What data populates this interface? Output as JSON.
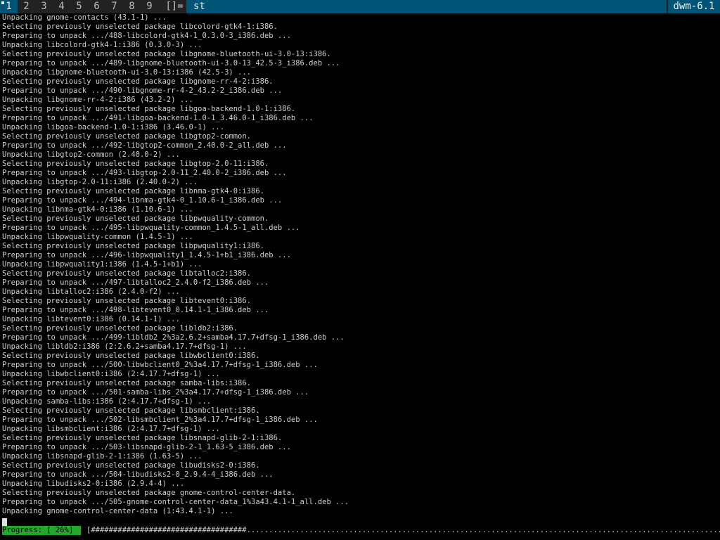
{
  "topbar": {
    "tags": [
      "1",
      "2",
      "3",
      "4",
      "5",
      "6",
      "7",
      "8",
      "9"
    ],
    "selected_tag": "1",
    "layout": "[]=",
    "window_title": "st",
    "status": "dwm-6.1"
  },
  "colors": {
    "bar_bg": "#222222",
    "accent": "#005577",
    "progress_green": "#22a82a"
  },
  "terminal": {
    "lines": [
      "Unpacking gnome-contacts (43.1-1) ...",
      "Selecting previously unselected package libcolord-gtk4-1:i386.",
      "Preparing to unpack .../488-libcolord-gtk4-1_0.3.0-3_i386.deb ...",
      "Unpacking libcolord-gtk4-1:i386 (0.3.0-3) ...",
      "Selecting previously unselected package libgnome-bluetooth-ui-3.0-13:i386.",
      "Preparing to unpack .../489-libgnome-bluetooth-ui-3.0-13_42.5-3_i386.deb ...",
      "Unpacking libgnome-bluetooth-ui-3.0-13:i386 (42.5-3) ...",
      "Selecting previously unselected package libgnome-rr-4-2:i386.",
      "Preparing to unpack .../490-libgnome-rr-4-2_43.2-2_i386.deb ...",
      "Unpacking libgnome-rr-4-2:i386 (43.2-2) ...",
      "Selecting previously unselected package libgoa-backend-1.0-1:i386.",
      "Preparing to unpack .../491-libgoa-backend-1.0-1_3.46.0-1_i386.deb ...",
      "Unpacking libgoa-backend-1.0-1:i386 (3.46.0-1) ...",
      "Selecting previously unselected package libgtop2-common.",
      "Preparing to unpack .../492-libgtop2-common_2.40.0-2_all.deb ...",
      "Unpacking libgtop2-common (2.40.0-2) ...",
      "Selecting previously unselected package libgtop-2.0-11:i386.",
      "Preparing to unpack .../493-libgtop-2.0-11_2.40.0-2_i386.deb ...",
      "Unpacking libgtop-2.0-11:i386 (2.40.0-2) ...",
      "Selecting previously unselected package libnma-gtk4-0:i386.",
      "Preparing to unpack .../494-libnma-gtk4-0_1.10.6-1_i386.deb ...",
      "Unpacking libnma-gtk4-0:i386 (1.10.6-1) ...",
      "Selecting previously unselected package libpwquality-common.",
      "Preparing to unpack .../495-libpwquality-common_1.4.5-1_all.deb ...",
      "Unpacking libpwquality-common (1.4.5-1) ...",
      "Selecting previously unselected package libpwquality1:i386.",
      "Preparing to unpack .../496-libpwquality1_1.4.5-1+b1_i386.deb ...",
      "Unpacking libpwquality1:i386 (1.4.5-1+b1) ...",
      "Selecting previously unselected package libtalloc2:i386.",
      "Preparing to unpack .../497-libtalloc2_2.4.0-f2_i386.deb ...",
      "Unpacking libtalloc2:i386 (2.4.0-f2) ...",
      "Selecting previously unselected package libtevent0:i386.",
      "Preparing to unpack .../498-libtevent0_0.14.1-1_i386.deb ...",
      "Unpacking libtevent0:i386 (0.14.1-1) ...",
      "Selecting previously unselected package libldb2:i386.",
      "Preparing to unpack .../499-libldb2_2%3a2.6.2+samba4.17.7+dfsg-1_i386.deb ...",
      "Unpacking libldb2:i386 (2:2.6.2+samba4.17.7+dfsg-1) ...",
      "Selecting previously unselected package libwbclient0:i386.",
      "Preparing to unpack .../500-libwbclient0_2%3a4.17.7+dfsg-1_i386.deb ...",
      "Unpacking libwbclient0:i386 (2:4.17.7+dfsg-1) ...",
      "Selecting previously unselected package samba-libs:i386.",
      "Preparing to unpack .../501-samba-libs_2%3a4.17.7+dfsg-1_i386.deb ...",
      "Unpacking samba-libs:i386 (2:4.17.7+dfsg-1) ...",
      "Selecting previously unselected package libsmbclient:i386.",
      "Preparing to unpack .../502-libsmbclient_2%3a4.17.7+dfsg-1_i386.deb ...",
      "Unpacking libsmbclient:i386 (2:4.17.7+dfsg-1) ...",
      "Selecting previously unselected package libsnapd-glib-2-1:i386.",
      "Preparing to unpack .../503-libsnapd-glib-2-1_1.63-5_i386.deb ...",
      "Unpacking libsnapd-glib-2-1:i386 (1.63-5) ...",
      "Selecting previously unselected package libudisks2-0:i386.",
      "Preparing to unpack .../504-libudisks2-0_2.9.4-4_i386.deb ...",
      "Unpacking libudisks2-0:i386 (2.9.4-4) ...",
      "Selecting previously unselected package gnome-control-center-data.",
      "Preparing to unpack .../505-gnome-control-center-data_1%3a43.4.1-1_all.deb ...",
      "Unpacking gnome-control-center-data (1:43.4.1-1) ..."
    ],
    "progress_label": "Progress: [ 26%]",
    "progress_bar": "[###################################...........................................................................................................]",
    "progress_fraction": 0.26
  }
}
